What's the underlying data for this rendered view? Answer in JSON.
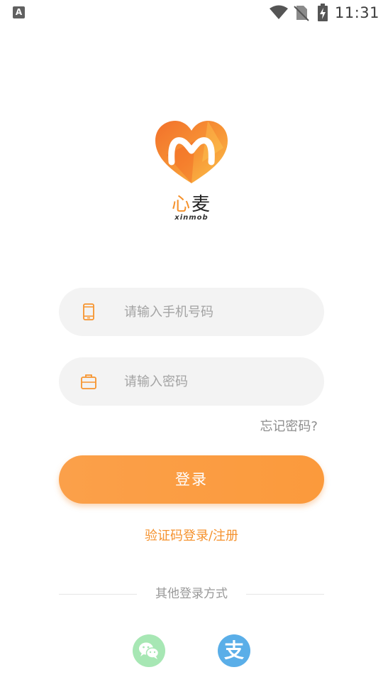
{
  "status_bar": {
    "time": "11:31",
    "notification_badge": "A"
  },
  "logo": {
    "name_cn_part1": "心",
    "name_cn_part2": "麦",
    "name_en": "xinmob",
    "brand_color": "#f5912b"
  },
  "login_form": {
    "phone_placeholder": "请输入手机号码",
    "password_placeholder": "请输入密码",
    "forgot_password": "忘记密码?",
    "login_button": "登录",
    "sms_register_link": "验证码登录/注册"
  },
  "other_login": {
    "label": "其他登录方式",
    "alipay_glyph": "支",
    "icons": [
      "wechat-icon",
      "alipay-icon"
    ]
  },
  "colors": {
    "accent": "#fb9c40",
    "wechat": "#a7e7b4",
    "alipay": "#5aaee8"
  }
}
